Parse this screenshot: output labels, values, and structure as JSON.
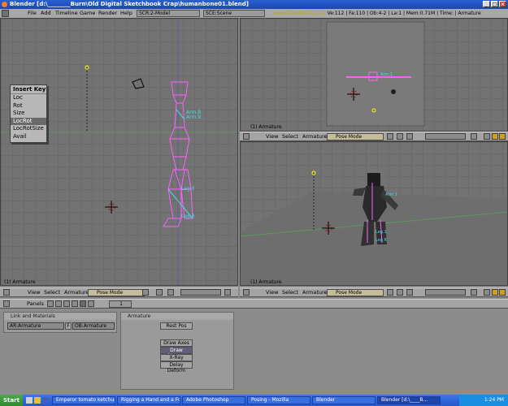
{
  "window": {
    "title": "Blender [d:\\________Burn\\Old Digital Sketchbook Crap\\humanbone01.blend]",
    "btn_min": "_",
    "btn_max": "□",
    "btn_close": "×"
  },
  "topmenu": {
    "items": [
      "File",
      "Add",
      "Timeline",
      "Game",
      "Render",
      "Help"
    ],
    "screen_field": "SCR:2-Model",
    "scene_field": "SCE:Scene",
    "info_url": "www.blender.org 234",
    "info_stats": "Ve:112 | Fa:110 | Ob:4-2 | La:1 | Mem:0.71M | Time: | Armature"
  },
  "insert_key_menu": {
    "title": "Insert Key",
    "items": [
      "Loc",
      "Rot",
      "Size",
      "LocRot",
      "LocRotSize",
      "Avail"
    ],
    "selected": "LocRot"
  },
  "viewports": {
    "left_label": "(1) Armature",
    "topright_label": "(1) Armature",
    "bottomright_label": "(1) Armature",
    "bone_labels": [
      "Arm.8",
      "Arm.9",
      "Leg.0",
      "Leg.R"
    ],
    "small_bone_labels": [
      "Arm.1",
      "Arm.1",
      "Leg.1",
      "Leg.R"
    ]
  },
  "view_header": {
    "view": "View",
    "select": "Select",
    "armature": "Armature",
    "mode": "Pose Mode"
  },
  "buttons_header": {
    "panels_label": "Panels",
    "frame_value": "1"
  },
  "link_panel": {
    "title": "Link and Materials",
    "ar_field": "AR:Armature",
    "f_field": "F",
    "ob_field": "OB:Armature"
  },
  "armature_panel": {
    "title": "Armature",
    "rest_pos": "Rest Pos",
    "draw_axes": "Draw Axes",
    "draw_names": "Draw Names",
    "xray": "X-Ray",
    "delay_deform": "Delay Deform"
  },
  "taskbar": {
    "start": "Start",
    "tasks": [
      "Emperor tomato ketchup",
      "Rigging a Hand and a Foo...",
      "Adobe Photoshop",
      "Posing - Mozilla",
      "Blender",
      "Blender [d:\\____B..."
    ],
    "time": "1:24 PM"
  }
}
